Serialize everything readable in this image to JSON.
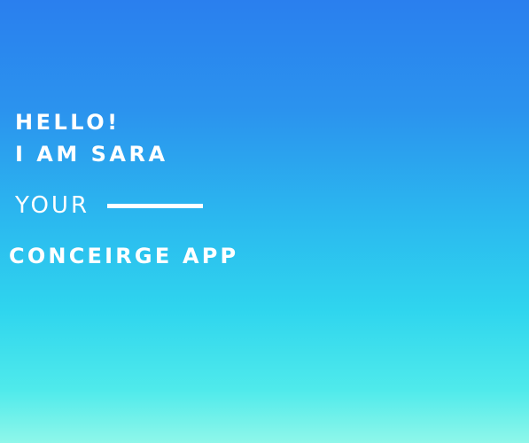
{
  "intro": {
    "line1": "HELLO!",
    "line2": "I AM SARA",
    "your": "YOUR",
    "app_name": "CONCEIRGE APP"
  },
  "colors": {
    "gradient_top": "#2a7fee",
    "gradient_middle": "#2bb9ef",
    "gradient_bottom": "#8ff7ea",
    "text": "#ffffff"
  }
}
